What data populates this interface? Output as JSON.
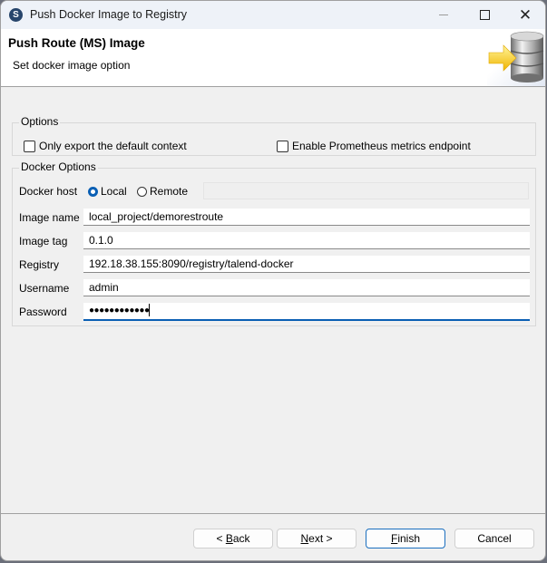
{
  "window": {
    "title": "Push Docker Image to Registry",
    "app_icon_glyph": "S",
    "controls": {
      "minimize": "minimize-icon",
      "maximize": "maximize-icon",
      "close": "close-icon"
    }
  },
  "banner": {
    "title": "Push Route (MS) Image",
    "subtitle": "Set docker image option",
    "image": "database-push-icon"
  },
  "options": {
    "label": "Options",
    "only_export_default_context": {
      "label": "Only export the default context",
      "checked": false
    },
    "enable_prometheus": {
      "label": "Enable Prometheus metrics endpoint",
      "checked": false
    }
  },
  "docker_options": {
    "label": "Docker Options",
    "docker_host": {
      "label": "Docker host",
      "options": [
        {
          "label": "Local",
          "selected": true
        },
        {
          "label": "Remote",
          "selected": false
        }
      ],
      "remote_value": ""
    },
    "fields": [
      {
        "label": "Image name",
        "value": "local_project/demorestroute"
      },
      {
        "label": "Image tag",
        "value": "0.1.0"
      },
      {
        "label": "Registry",
        "value": "192.18.38.155:8090/registry/talend-docker"
      },
      {
        "label": "Username",
        "value": "admin"
      },
      {
        "label": "Password",
        "value": "●●●●●●●●●●●●"
      }
    ]
  },
  "buttons": {
    "back": {
      "prefix": "< ",
      "mnemonic": "B",
      "rest": "ack"
    },
    "next": {
      "mnemonic": "N",
      "rest": "ext >"
    },
    "finish": {
      "mnemonic": "F",
      "rest": "inish"
    },
    "cancel": {
      "label": "Cancel"
    }
  }
}
